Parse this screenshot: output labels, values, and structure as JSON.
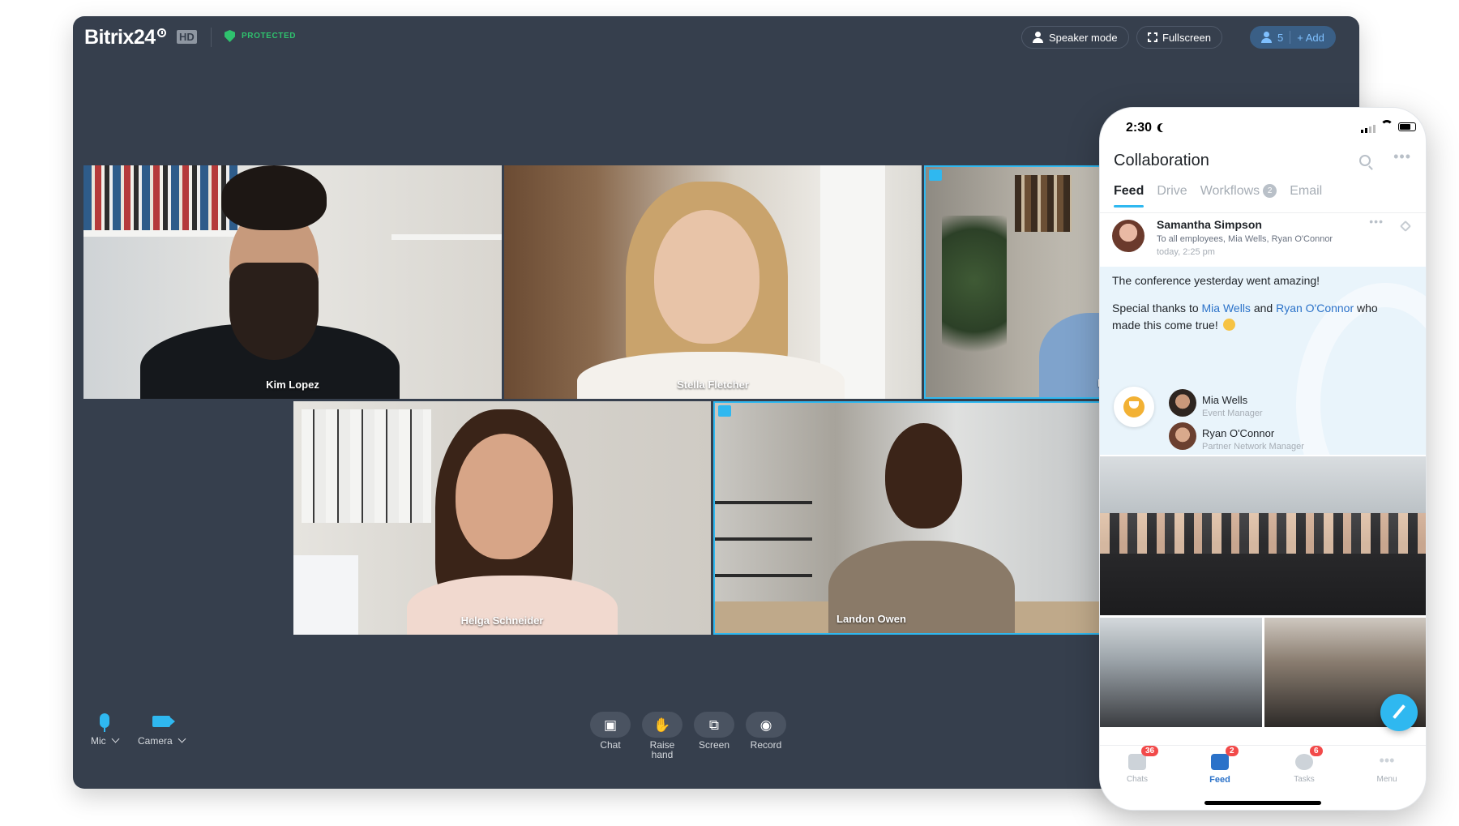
{
  "call": {
    "brand": "Bitrix24",
    "hd_badge": "HD",
    "protected_label": "PROTECTED",
    "speaker_mode": "Speaker mode",
    "fullscreen": "Fullscreen",
    "participants_count": "5",
    "add_label": "+ Add",
    "tiles": [
      {
        "name": "Kim Lopez",
        "active": false
      },
      {
        "name": "Stella Fletcher",
        "active": false
      },
      {
        "name": "Lu",
        "active": true
      },
      {
        "name": "Helga Schneider",
        "active": false
      },
      {
        "name": "Landon Owen",
        "active": true
      }
    ],
    "controls": {
      "mic": "Mic",
      "camera": "Camera",
      "chat": "Chat",
      "raise_hand_1": "Raise",
      "raise_hand_2": "hand",
      "screen": "Screen",
      "record": "Record"
    },
    "accent_color": "#2fb8f0",
    "background_color": "#363f4d"
  },
  "phone": {
    "time": "2:30",
    "app_title": "Collaboration",
    "tabs": [
      "Feed",
      "Drive",
      "Workflows",
      "Email"
    ],
    "workflows_count": "2",
    "post": {
      "author": "Samantha Simpson",
      "recipients": "To all employees, Mia Wells, Ryan O'Connor",
      "timestamp": "today, 2:25 pm",
      "line1": "The conference yesterday went amazing!",
      "line2_prefix": "Special thanks to ",
      "mention1": "Mia Wells",
      "line2_mid": " and ",
      "mention2": "Ryan O'Connor",
      "line2_suffix": " who",
      "line3": "made this come true!",
      "people": [
        {
          "name": "Mia Wells",
          "role": "Event Manager"
        },
        {
          "name": "Ryan O'Connor",
          "role": "Partner Network Manager"
        }
      ]
    },
    "nav": [
      {
        "label": "Chats",
        "badge": "36"
      },
      {
        "label": "Feed",
        "badge": "2"
      },
      {
        "label": "Tasks",
        "badge": "6"
      },
      {
        "label": "Menu",
        "badge": ""
      }
    ]
  }
}
